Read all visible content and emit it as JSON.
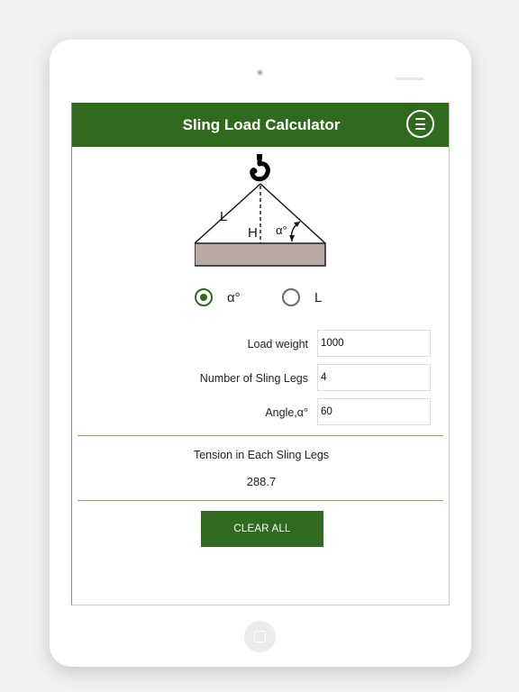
{
  "app": {
    "title": "Sling Load Calculator"
  },
  "diagram": {
    "length_label": "L",
    "height_label": "H",
    "angle_label": "α°"
  },
  "mode": {
    "options": [
      {
        "label": "α°",
        "selected": true
      },
      {
        "label": "L",
        "selected": false
      }
    ]
  },
  "form": {
    "load_weight": {
      "label": "Load weight",
      "value": "1000"
    },
    "sling_legs": {
      "label": "Number of Sling Legs",
      "value": "4"
    },
    "angle": {
      "label": "Angle,α°",
      "value": "60"
    }
  },
  "result": {
    "label": "Tension in Each Sling Legs",
    "value": "288.7"
  },
  "actions": {
    "clear_label": "CLEAR ALL"
  },
  "colors": {
    "primary": "#2f6a1e",
    "divider": "#7db35f",
    "load_fill": "#b9a9a5"
  },
  "icons": {
    "menu": "menu-lines-icon",
    "hook": "crane-hook-icon",
    "home": "home-button-icon"
  }
}
